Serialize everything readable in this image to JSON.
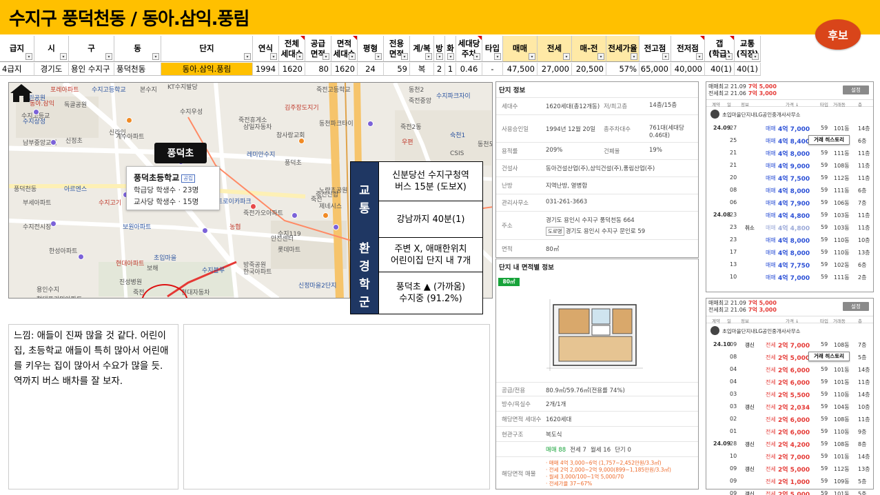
{
  "page": {
    "title": "수지구 풍덕천동 / 동아.삼익.풍림",
    "candidate_badge": "후보"
  },
  "table": {
    "headers": [
      "급지",
      "시",
      "구",
      "동",
      "단지",
      "연식",
      "전체\n세대수",
      "공급\n면적",
      "면적\n세대수",
      "평형",
      "전용\n면적",
      "계/복",
      "방",
      "화",
      "세대당\n주차",
      "타입",
      "매매",
      "전세",
      "매-전",
      "전세가율",
      "전고점",
      "전저점",
      "갭\n(학급)",
      "교통\n(직장)"
    ],
    "row": [
      "4급지",
      "경기도",
      "용인 수지구",
      "풍덕천동",
      "동아.삼익.풍림",
      "1994",
      "1620",
      "80",
      "1620",
      "24",
      "59",
      "복",
      "2",
      "1",
      "0.46",
      "-",
      "47,500",
      "27,000",
      "20,500",
      "57%",
      "65,000",
      "40,000",
      "40(1)",
      "40(1)"
    ]
  },
  "map": {
    "callout": "풍덕초",
    "school": {
      "name": "풍덕초등학교",
      "tag": "공립",
      "students_per_class": "학급당 학생수 · 23명",
      "students_per_teacher": "교사당 학생수 · 15명"
    },
    "labels": [
      "포레아파트",
      "수지고등학교",
      "본수지",
      "KT수지발당",
      "죽전고등학교",
      "동천2",
      "근린공원",
      "동아.삼익",
      "수지우성",
      "죽전휴게소",
      "죽전중앙",
      "수지파크자이",
      "수지고등교",
      "독골공원",
      "김주장도지기",
      "동천파크타이",
      "수지상성",
      "신라인",
      "삼일자동차",
      "참사랑교회",
      "죽전2동",
      "숙천1",
      "동천도서관",
      "남부중앙교회",
      "신정초",
      "계수아파트",
      "레미안수지",
      "풍덕초",
      "우편",
      "CSIS",
      "풍덕천동",
      "아르엔스",
      "죽전신합",
      "노량초공원",
      "부세아파트",
      "수지고기",
      "트로이카파크",
      "죽전가오아파트",
      "죽전",
      "제네시스",
      "수지전시장",
      "보원아파트",
      "농협",
      "수지119",
      "안전센터",
      "롯데마트",
      "초입마을",
      "방죽공원",
      "한성아파트",
      "현대아파트",
      "보해",
      "수지블루",
      "한국아파트",
      "진성병원",
      "죽전",
      "현대자동차",
      "신정마을2단지",
      "용인수지",
      "풍덕천2",
      "현대프리미아파트"
    ]
  },
  "transport": {
    "side_top": [
      "교",
      "통"
    ],
    "side_bottom": [
      "환",
      "경",
      "학",
      "군"
    ],
    "cells": [
      "신분당선 수지구청역\n버스 15분 (도보X)",
      "강남까지 40분(1)",
      "주변 X, 애매한위치\n어린이집 단지 내 7개",
      "풍덕초 ▲ (가까움)\n수지중 (91.2%)"
    ]
  },
  "note": {
    "text": "느낌: 애들이 진짜 많을 것 같다. 어린이집, 초등학교 애들이 특히 많아서 어린애를 키우는 집이 많아서 수요가 많을 듯. 역까지 버스 배차를 잘 보자."
  },
  "complex_info": {
    "title": "단지 정보",
    "rows": [
      {
        "k": "세대수",
        "v": "1620세대(총12개동)",
        "k2": "저/최고층",
        "v2": "14층/15층"
      },
      {
        "k": "사용승인일",
        "v": "1994년 12월 20일",
        "k2": "총주차대수",
        "v2": "761대(세대당 0.46대)"
      },
      {
        "k": "용적률",
        "v": "209%",
        "k2": "건폐율",
        "v2": "19%"
      },
      {
        "k": "건설사",
        "v": "동아건설산업(주),삼익건설(주),풍림산업(주)",
        "k2": "",
        "v2": ""
      },
      {
        "k": "난방",
        "v": "지역난방, 열병합",
        "k2": "",
        "v2": ""
      },
      {
        "k": "관리사무소",
        "v": "031-261-3663",
        "k2": "",
        "v2": ""
      },
      {
        "k": "주소",
        "v": "경기도 용인시 수지구 풍덕천동 664",
        "k2": "",
        "v2": ""
      },
      {
        "k": "면적",
        "v": "80㎡",
        "k2": "",
        "v2": ""
      }
    ],
    "road_tag": "도로명",
    "road_address": "경기도 용인시 수지구 문인로 59"
  },
  "area_info": {
    "title": "단지 내 면적별 정보",
    "badge": "80㎡",
    "rows": [
      {
        "k": "공급/전용",
        "v": "80.9㎡/59.76㎡(전용률 74%)"
      },
      {
        "k": "방수/욕실수",
        "v": "2개/1개"
      },
      {
        "k": "해당면적 세대수",
        "v": "1620세대"
      },
      {
        "k": "현관구조",
        "v": "복도식"
      }
    ],
    "counts": {
      "sale": "매매 88",
      "jeonse": "전세 7",
      "monthly": "월세 16",
      "short": "단기 0"
    },
    "price_k": "해당면적 매물",
    "price_lines": [
      "· 매매 4억 3,000~6억 (1,757~2,452만원/3.3㎡)",
      "· 전세 2억 2,000~2억 9,000(899~1,185만원/3.3㎡)",
      "· 월세 3,000/100~1억 5,000/70",
      "· 전세가율 37~67%"
    ]
  },
  "trade_sale": {
    "high1": "매매최고 21.09",
    "high1_v": "7억 5,000",
    "high2": "전세최고 21.06",
    "high2_v": "7억 3,000",
    "setting": "설정",
    "header": [
      "계약",
      "일",
      "정보",
      "가격 ↓",
      "타입",
      "거래동",
      "층"
    ],
    "agent": "초입마을단지내LG공인중개사사무소",
    "tooltip": "거래 히스토리",
    "rows": [
      {
        "m": "24.09",
        "d": "27",
        "tag": "",
        "kind": "매매",
        "price": "4억 7,000",
        "type": "59",
        "dong": "101동",
        "fl": "14층"
      },
      {
        "m": "",
        "d": "25",
        "tag": "",
        "kind": "매매",
        "price": "4억 8,400",
        "type": "59",
        "dong": "",
        "fl": "6층"
      },
      {
        "m": "",
        "d": "21",
        "tag": "",
        "kind": "매매",
        "price": "4억 8,000",
        "type": "59",
        "dong": "111동",
        "fl": "11층"
      },
      {
        "m": "",
        "d": "21",
        "tag": "",
        "kind": "매매",
        "price": "4억 9,000",
        "type": "59",
        "dong": "108동",
        "fl": "11층"
      },
      {
        "m": "",
        "d": "20",
        "tag": "",
        "kind": "매매",
        "price": "4억 7,500",
        "type": "59",
        "dong": "112동",
        "fl": "11층"
      },
      {
        "m": "",
        "d": "08",
        "tag": "",
        "kind": "매매",
        "price": "4억 8,000",
        "type": "59",
        "dong": "111동",
        "fl": "6층"
      },
      {
        "m": "",
        "d": "06",
        "tag": "",
        "kind": "매매",
        "price": "4억 7,900",
        "type": "59",
        "dong": "106동",
        "fl": "7층"
      },
      {
        "m": "24.08",
        "d": "23",
        "tag": "",
        "kind": "매매",
        "price": "4억 4,800",
        "type": "59",
        "dong": "103동",
        "fl": "11층"
      },
      {
        "m": "",
        "d": "23",
        "tag": "취소",
        "kind": "매매",
        "price": "4억 4,800",
        "type": "59",
        "dong": "103동",
        "fl": "11층"
      },
      {
        "m": "",
        "d": "23",
        "tag": "",
        "kind": "매매",
        "price": "4억 8,000",
        "type": "59",
        "dong": "110동",
        "fl": "10층"
      },
      {
        "m": "",
        "d": "17",
        "tag": "",
        "kind": "매매",
        "price": "4억 8,000",
        "type": "59",
        "dong": "110동",
        "fl": "13층"
      },
      {
        "m": "",
        "d": "13",
        "tag": "",
        "kind": "매매",
        "price": "4억 7,750",
        "type": "59",
        "dong": "102동",
        "fl": "6층"
      },
      {
        "m": "",
        "d": "10",
        "tag": "",
        "kind": "매매",
        "price": "4억 7,000",
        "type": "59",
        "dong": "111동",
        "fl": "2층"
      }
    ]
  },
  "trade_jeonse": {
    "high1": "매매최고 21.09",
    "high1_v": "7억 5,000",
    "high2": "전세최고 21.06",
    "high2_v": "7억 3,000",
    "setting": "설정",
    "header": [
      "계약",
      "일",
      "정보",
      "가격 ↓",
      "타입",
      "거래동",
      "층"
    ],
    "agent": "초입마을단지내LG공인중개사사무소",
    "tooltip": "거래 히스토리",
    "rows": [
      {
        "m": "24.10",
        "d": "09",
        "tag": "갱신",
        "kind": "전세",
        "price": "2억 7,000",
        "type": "59",
        "dong": "108동",
        "fl": "7층"
      },
      {
        "m": "",
        "d": "08",
        "tag": "",
        "kind": "전세",
        "price": "2억 5,000",
        "type": "59",
        "dong": "",
        "fl": "5층"
      },
      {
        "m": "",
        "d": "04",
        "tag": "",
        "kind": "전세",
        "price": "2억 6,000",
        "type": "59",
        "dong": "101동",
        "fl": "14층"
      },
      {
        "m": "",
        "d": "04",
        "tag": "",
        "kind": "전세",
        "price": "2억 6,000",
        "type": "59",
        "dong": "101동",
        "fl": "11층"
      },
      {
        "m": "",
        "d": "03",
        "tag": "",
        "kind": "전세",
        "price": "2억 5,500",
        "type": "59",
        "dong": "110동",
        "fl": "14층"
      },
      {
        "m": "",
        "d": "03",
        "tag": "갱신",
        "kind": "전세",
        "price": "2억 2,034",
        "type": "59",
        "dong": "104동",
        "fl": "10층"
      },
      {
        "m": "",
        "d": "02",
        "tag": "",
        "kind": "전세",
        "price": "2억 6,000",
        "type": "59",
        "dong": "108동",
        "fl": "11층"
      },
      {
        "m": "",
        "d": "01",
        "tag": "",
        "kind": "전세",
        "price": "2억 6,000",
        "type": "59",
        "dong": "110동",
        "fl": "9층"
      },
      {
        "m": "24.09",
        "d": "28",
        "tag": "갱신",
        "kind": "전세",
        "price": "2억 4,200",
        "type": "59",
        "dong": "108동",
        "fl": "8층"
      },
      {
        "m": "",
        "d": "10",
        "tag": "",
        "kind": "전세",
        "price": "2억 7,000",
        "type": "59",
        "dong": "101동",
        "fl": "14층"
      },
      {
        "m": "",
        "d": "09",
        "tag": "갱신",
        "kind": "전세",
        "price": "2억 5,000",
        "type": "59",
        "dong": "112동",
        "fl": "13층"
      },
      {
        "m": "",
        "d": "09",
        "tag": "",
        "kind": "전세",
        "price": "2억 1,000",
        "type": "59",
        "dong": "109동",
        "fl": "5층"
      },
      {
        "m": "",
        "d": "09",
        "tag": "갱신",
        "kind": "전세",
        "price": "2억 5,000",
        "type": "59",
        "dong": "101동",
        "fl": "5층"
      }
    ]
  }
}
